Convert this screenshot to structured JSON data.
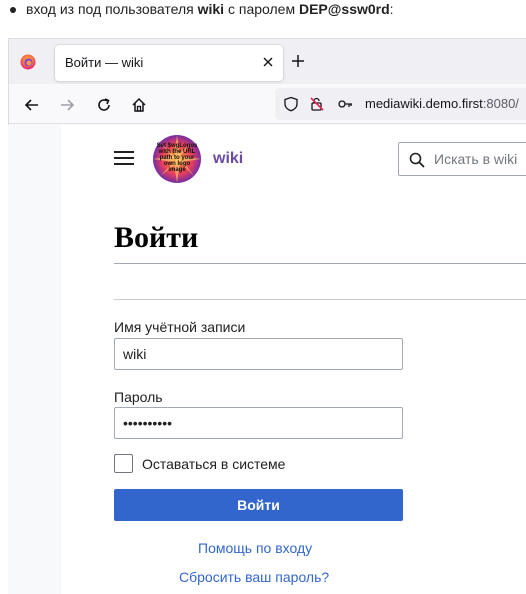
{
  "note": {
    "prefix": "вход из под пользователя ",
    "user": "wiki",
    "middle": " с паролем ",
    "password": "DEP@ssw0rd",
    "suffix": ":"
  },
  "browser": {
    "tab_title": "Войти — wiki",
    "url_host": "mediawiki.demo.first",
    "url_port": ":8080/",
    "icons": [
      "firefox-logo",
      "close-icon",
      "plus-icon",
      "back-icon",
      "forward-icon",
      "reload-icon",
      "home-icon",
      "shield-icon",
      "permissions-icon",
      "key-icon"
    ]
  },
  "header": {
    "logo_text": "Set $wgLogos with the URL path to your own logo image",
    "wordmark": "wiki",
    "search_placeholder": "Искать в wiki"
  },
  "form": {
    "title": "Войти",
    "username_label": "Имя учётной записи",
    "username_value": "wiki",
    "password_label": "Пароль",
    "password_value": "••••••••••",
    "remember_label": "Оставаться в системе",
    "remember_checked": false,
    "submit_label": "Войти",
    "help_link": "Помощь по входу",
    "reset_link": "Сбросить ваш пароль?"
  },
  "colors": {
    "accent": "#3366cc",
    "wordmark": "#6b4ba1"
  }
}
